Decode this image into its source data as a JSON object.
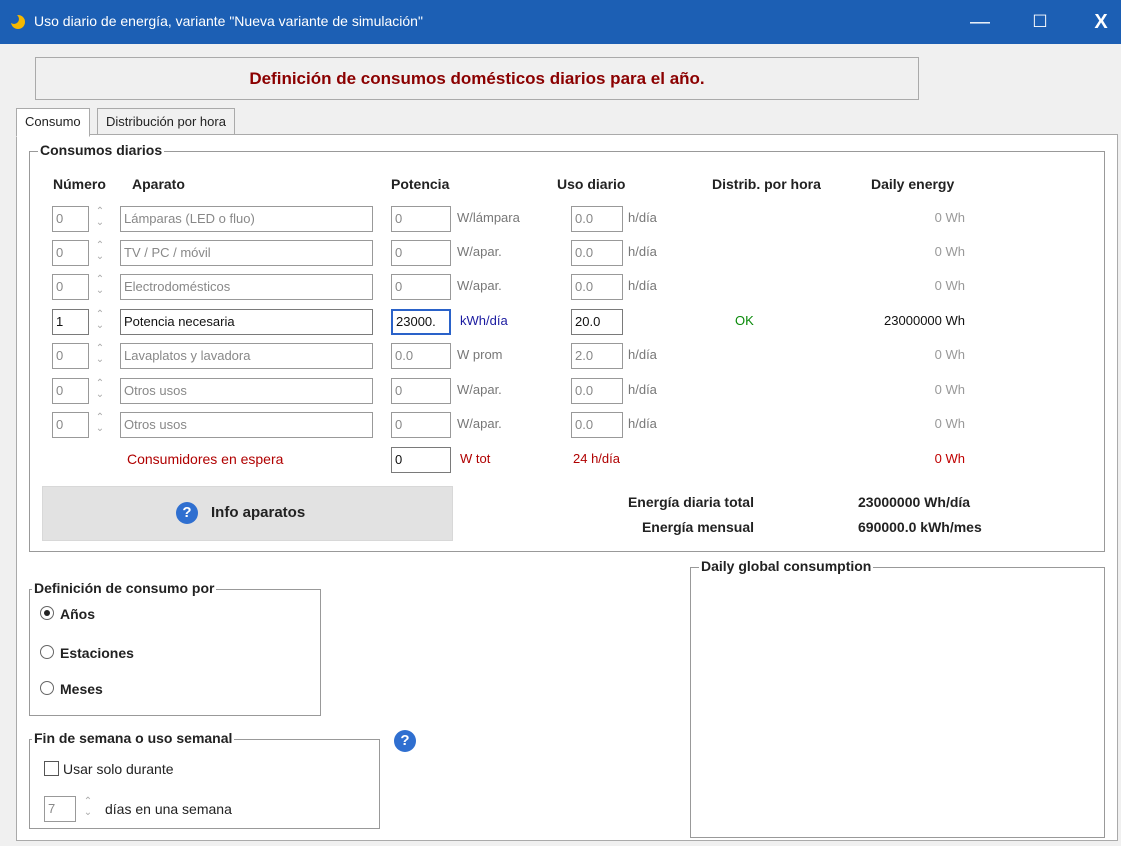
{
  "window": {
    "title": "Uso diario de energía, variante \"Nueva variante de simulación\"",
    "minimize_glyph": "—",
    "maximize_glyph": "☐",
    "close_glyph": "X"
  },
  "header": {
    "text": "Definición de consumos domésticos diarios para el año."
  },
  "tabs": [
    {
      "label": "Consumo"
    },
    {
      "label": "Distribución por hora"
    }
  ],
  "consumos": {
    "title": "Consumos diarios",
    "columns": {
      "numero": "Número",
      "aparato": "Aparato",
      "potencia": "Potencia",
      "uso": "Uso diario",
      "distrib": "Distrib. por hora",
      "energy": "Daily energy"
    },
    "rows": [
      {
        "numero": "0",
        "aparato": "Lámparas (LED o fluo)",
        "potencia": "0",
        "pot_unit": "W/lámpara",
        "uso": "0.0",
        "uso_unit": "h/día",
        "distrib": "",
        "energy": "0  Wh"
      },
      {
        "numero": "0",
        "aparato": "TV / PC / móvil",
        "potencia": "0",
        "pot_unit": "W/apar.",
        "uso": "0.0",
        "uso_unit": "h/día",
        "distrib": "",
        "energy": "0  Wh"
      },
      {
        "numero": "0",
        "aparato": "Electrodomésticos",
        "potencia": "0",
        "pot_unit": "W/apar.",
        "uso": "0.0",
        "uso_unit": "h/día",
        "distrib": "",
        "energy": "0  Wh"
      },
      {
        "numero": "1",
        "aparato": "Potencia necesaria",
        "potencia": "23000.",
        "pot_unit": "kWh/día",
        "uso": "20.0",
        "uso_unit": "",
        "distrib": "OK",
        "energy": "23000000  Wh"
      },
      {
        "numero": "0",
        "aparato": "Lavaplatos y lavadora",
        "potencia": "0.0",
        "pot_unit": "W prom",
        "uso": "2.0",
        "uso_unit": "h/día",
        "distrib": "",
        "energy": "0  Wh"
      },
      {
        "numero": "0",
        "aparato": "Otros usos",
        "potencia": "0",
        "pot_unit": "W/apar.",
        "uso": "0.0",
        "uso_unit": "h/día",
        "distrib": "",
        "energy": "0  Wh"
      },
      {
        "numero": "0",
        "aparato": "Otros usos",
        "potencia": "0",
        "pot_unit": "W/apar.",
        "uso": "0.0",
        "uso_unit": "h/día",
        "distrib": "",
        "energy": "0  Wh"
      }
    ],
    "standby": {
      "label": "Consumidores en espera",
      "potencia": "0",
      "pot_unit": "W tot",
      "uso_text": "24 h/día",
      "energy": "0  Wh"
    },
    "info_button": "Info aparatos",
    "total_daily_label": "Energía diaria total",
    "total_daily_value": "23000000  Wh/día",
    "total_monthly_label": "Energía mensual",
    "total_monthly_value": "690000.0  kWh/mes"
  },
  "definicion": {
    "title": "Definición de consumo por",
    "options": [
      {
        "label": "Años",
        "selected": true
      },
      {
        "label": "Estaciones",
        "selected": false
      },
      {
        "label": "Meses",
        "selected": false
      }
    ]
  },
  "fin_semana": {
    "title": "Fin de semana o uso semanal",
    "checkbox_label": "Usar solo durante",
    "checked": false,
    "days_value": "7",
    "days_label": "días en una semana"
  },
  "daily_global": {
    "title": "Daily global consumption"
  },
  "icons": {
    "app": "sun-moon-icon",
    "help": "question-icon"
  },
  "colors": {
    "titlebar": "#1c5fb4",
    "header_text": "#8b0000",
    "ok": "#0a8a0a",
    "standby_red": "#b00000",
    "help_blue": "#2f6fd0",
    "focus_border": "#2a62c9"
  }
}
